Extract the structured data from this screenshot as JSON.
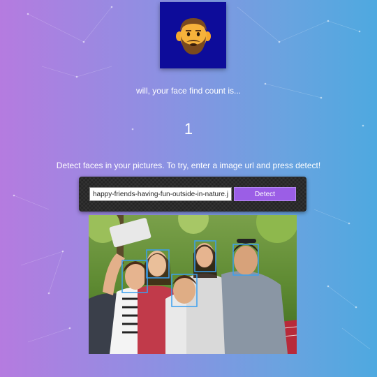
{
  "header": {
    "logo_icon": "bearded-man-emoji-icon",
    "logo_bg": "#0d0c9a"
  },
  "result": {
    "message": "will, your face find count is...",
    "count": "1"
  },
  "instructions": {
    "text": "Detect faces in your pictures. To try, enter a image url and press detect!"
  },
  "form": {
    "url_value": "happy-friends-having-fun-outside-in-nature.jpg",
    "detect_label": "Detect"
  },
  "photo": {
    "description_icon": "group-selfie-photo",
    "face_box_color": "#3aa0f0"
  },
  "colors": {
    "gradient_left": "#b57be0",
    "gradient_right": "#4ea9e0",
    "button": "#9b5ee6",
    "panel": "#232323"
  }
}
